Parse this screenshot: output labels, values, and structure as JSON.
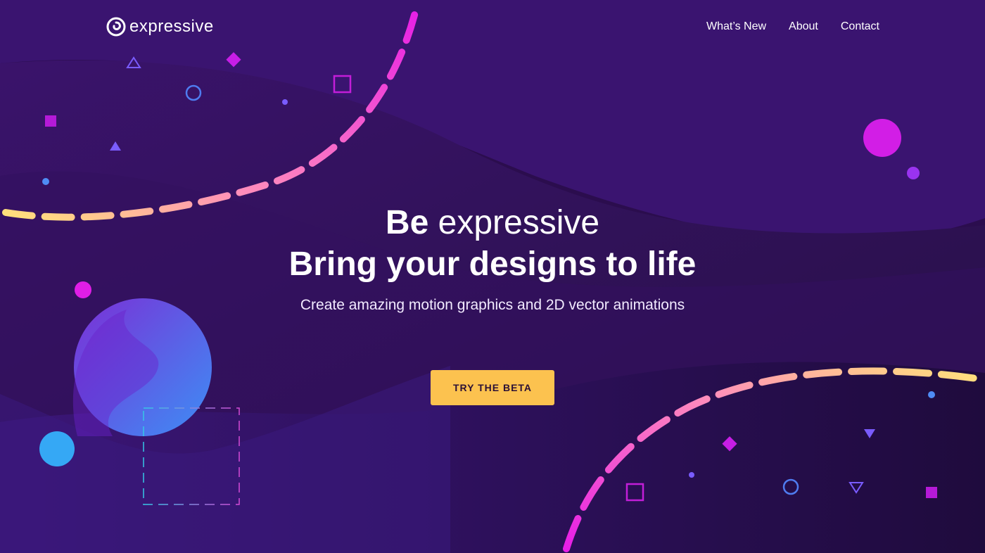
{
  "colors": {
    "background": "#2a0d4a",
    "accent_magenta": "#e61ee6",
    "accent_pink": "#ff7ac8",
    "accent_yellow": "#ffe27a",
    "accent_blue": "#35a8f5",
    "accent_violet": "#7a4bff",
    "cta_background": "#fcc24f",
    "cta_text": "#2b1036"
  },
  "nav": {
    "logo_icon": "swirl-logo-icon",
    "brand": "expressive",
    "links": [
      "What’s New",
      "About",
      "Contact"
    ]
  },
  "hero": {
    "title_bold": "Be",
    "title_light": "expressive",
    "subtitle": "Bring your designs to life",
    "description": "Create amazing motion graphics and 2D vector animations"
  },
  "cta": {
    "label": "TRY THE BETA"
  },
  "decorations": {
    "icons": [
      "circle-icon",
      "square-icon",
      "triangle-icon",
      "diamond-icon",
      "dashed-arc"
    ]
  }
}
